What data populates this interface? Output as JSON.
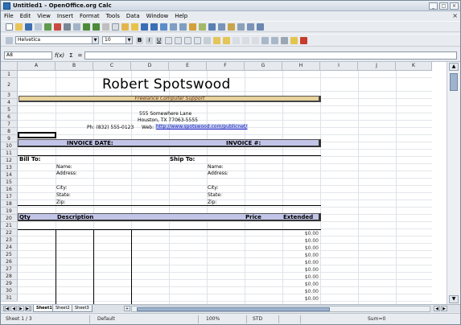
{
  "window": {
    "title": "Untitled1 - OpenOffice.org Calc"
  },
  "menu": [
    "File",
    "Edit",
    "View",
    "Insert",
    "Format",
    "Tools",
    "Data",
    "Window",
    "Help"
  ],
  "formatting": {
    "font_name": "Helvetica",
    "font_size": "10"
  },
  "formula_bar": {
    "cell_ref": "A8",
    "fx": "f(x)",
    "sum": "Σ",
    "equals": "=",
    "content": ""
  },
  "columns": [
    "A",
    "B",
    "C",
    "D",
    "E",
    "F",
    "G",
    "H",
    "I",
    "J",
    "K"
  ],
  "rows": [
    "1",
    "2",
    "3",
    "4",
    "5",
    "6",
    "7",
    "8",
    "9",
    "10",
    "11",
    "12",
    "13",
    "14",
    "15",
    "16",
    "17",
    "18",
    "19",
    "20",
    "21",
    "22",
    "23",
    "24",
    "25",
    "26",
    "27",
    "28",
    "29",
    "30",
    "31"
  ],
  "invoice": {
    "company_name": "Robert Spotswood",
    "tagline": "Freelance Computer Support",
    "address_line1": "555 Somewhere Lane",
    "address_line2": "Houston, TX 77063-5555",
    "phone": "Ph: (832) 555-0123",
    "web_label": "Web:",
    "web_url": "http://www.spotswood.com/publicnet/",
    "invoice_date_label": "INVOICE DATE:",
    "invoice_number_label": "INVOICE #:",
    "bill_to": "Bill To:",
    "ship_to": "Ship To:",
    "fields": [
      "Name:",
      "Address:",
      "City:",
      "State:",
      "Zip:"
    ],
    "table_headers": {
      "qty": "Qty",
      "description": "Description",
      "price": "Price",
      "extended": "Extended"
    },
    "line_amounts": [
      "$0.00",
      "$0.00",
      "$0.00",
      "$0.00",
      "$0.00",
      "$0.00",
      "$0.00",
      "$0.00",
      "$0.00",
      "$0.00",
      "$0.00"
    ]
  },
  "sheets": [
    "Sheet1",
    "Sheet2",
    "Sheet3"
  ],
  "status": {
    "sheet": "Sheet 1 / 3",
    "style": "Default",
    "zoom": "100%",
    "mode": "STD",
    "sum": "Sum=0"
  },
  "colors": {
    "band": "#c2c5e8",
    "tagline_band": "#e6d29a",
    "link": "#1a1ac8"
  }
}
